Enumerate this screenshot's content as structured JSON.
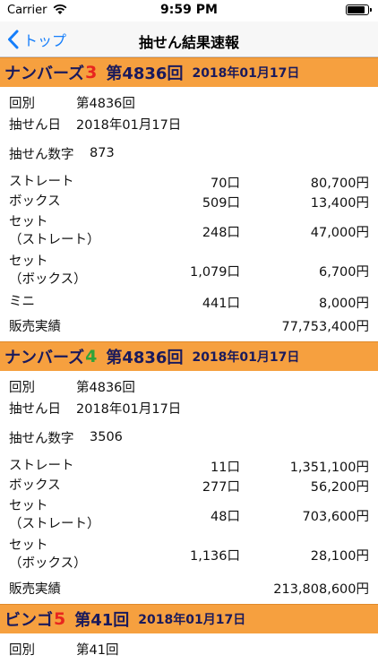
{
  "status_bar": {
    "carrier": "Carrier",
    "time": "9:59 PM",
    "battery_level": 0.9
  },
  "nav": {
    "back_label": "トップ",
    "title": "抽せん結果速報"
  },
  "colors": {
    "header_bg": "#f6a03f",
    "accent_blue": "#157efb",
    "digit_red": "#e8251f",
    "digit_green": "#2fa33a",
    "header_text": "#1a1a5c"
  },
  "labels": {
    "round": "回別",
    "date": "抽せん日",
    "number": "抽せん数字",
    "sales": "販売実績"
  },
  "sections": [
    {
      "game": "ナンバーズ",
      "digit": "3",
      "draw": "第4836回",
      "date": "2018年01月17日",
      "round": "第4836回",
      "draw_date": "2018年01月17日",
      "number": "873",
      "prizes": [
        {
          "name": "ストレート",
          "count": "70口",
          "amount": "80,700円"
        },
        {
          "name": "ボックス",
          "count": "509口",
          "amount": "13,400円"
        },
        {
          "name": "セット\n（ストレート）",
          "count": "248口",
          "amount": "47,000円"
        },
        {
          "name": "セット\n（ボックス）",
          "count": "1,079口",
          "amount": "6,700円"
        },
        {
          "name": "ミニ",
          "count": "441口",
          "amount": "8,000円"
        }
      ],
      "sales": "77,753,400円"
    },
    {
      "game": "ナンバーズ",
      "digit": "4",
      "draw": "第4836回",
      "date": "2018年01月17日",
      "round": "第4836回",
      "draw_date": "2018年01月17日",
      "number": "3506",
      "prizes": [
        {
          "name": "ストレート",
          "count": "11口",
          "amount": "1,351,100円"
        },
        {
          "name": "ボックス",
          "count": "277口",
          "amount": "56,200円"
        },
        {
          "name": "セット\n（ストレート）",
          "count": "48口",
          "amount": "703,600円"
        },
        {
          "name": "セット\n（ボックス）",
          "count": "1,136口",
          "amount": "28,100円"
        }
      ],
      "sales": "213,808,600円"
    },
    {
      "game": "ビンゴ",
      "digit": "5",
      "draw": "第41回",
      "date": "2018年01月17日",
      "round": "第41回"
    }
  ]
}
